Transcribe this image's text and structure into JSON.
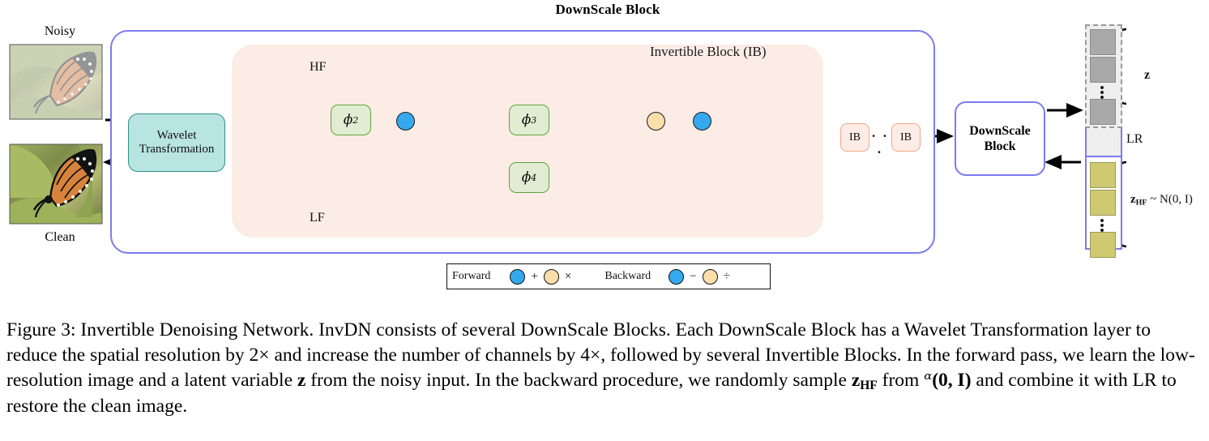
{
  "figure": {
    "title": "DownScale Block",
    "ib_panel_label": "Invertible Block (IB)"
  },
  "left_images": {
    "noisy_label": "Noisy",
    "clean_label": "Clean"
  },
  "wavelet": {
    "line1": "Wavelet",
    "line2": "Transformation"
  },
  "frequency": {
    "hf_label": "HF",
    "lf_label": "LF"
  },
  "phi_nodes": {
    "phi2": "ϕ",
    "phi2_sub": "2",
    "phi3": "ϕ",
    "phi3_sub": "3",
    "phi4": "ϕ",
    "phi4_sub": "4"
  },
  "ib_chain": {
    "ib_first": "IB",
    "ib_dots": "· · ·",
    "ib_last": "IB"
  },
  "downscale_block": {
    "line1": "DownScale",
    "line2": "Block"
  },
  "latent": {
    "z_label": "z",
    "lr_label": "LR",
    "zhf_label": "z",
    "zhf_sub": "HF",
    "zhf_dist": " ~ N(0, I)",
    "vdots": "•••"
  },
  "legend": {
    "forward_label": "Forward",
    "forward_op1": "+",
    "forward_op2": "×",
    "backward_label": "Backward",
    "backward_op1": "−",
    "backward_op2": "÷",
    "blue_color": "#35a9ef",
    "tan_color": "#fbdfab"
  },
  "caption": {
    "prefix": "Figure 3:",
    "text_1": " Invertible Denoising Network. InvDN consists of several DownScale Blocks. Each DownScale Block has a Wavelet Transformation layer to reduce the spatial resolution by 2",
    "times1": "×",
    "text_2": " and increase the number of channels by 4",
    "times2": "×",
    "text_3": ", followed by several Invertible Blocks. In the forward pass, we learn the low-resolution image and a latent variable ",
    "z": "z",
    "text_4": " from the noisy input. In the backward procedure, we randomly sample ",
    "zhf": "z",
    "zhf_sub": "HF",
    "text_5": " from ",
    "normal": "ᵅ",
    "normal_args": "(0, I)",
    "text_6": " and combine it with LR to restore the clean image."
  },
  "colors": {
    "container_border": "#7b7bf0",
    "ib_panel": "#fbece5",
    "wavelet_fill": "#b8e4e2",
    "wavelet_border": "#2f8f8a",
    "phi_fill": "#e2ecd3",
    "phi_border": "#5fa33f",
    "node_blue": "#35a9ef",
    "node_tan": "#fbdfab",
    "stack_purple": "#9a9cf0",
    "stack_green": "#7ec87e",
    "stack_blue": "#7fb6ec",
    "z_square": "#a9a9a9",
    "zhf_square": "#cfca72"
  }
}
